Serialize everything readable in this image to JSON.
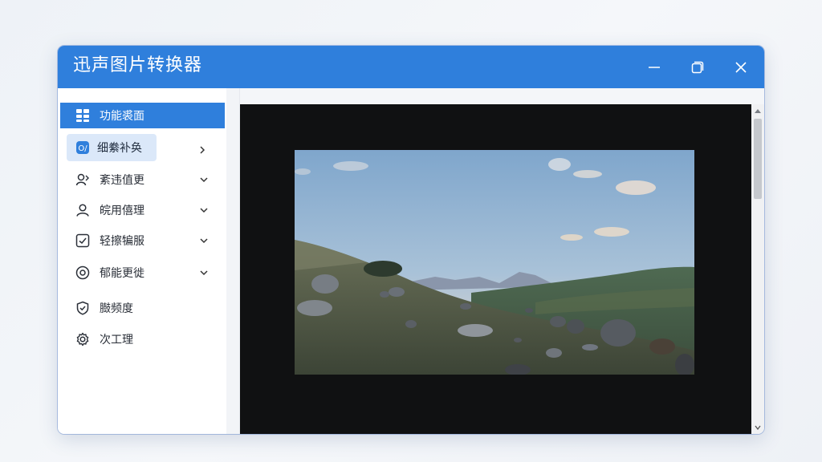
{
  "app": {
    "title": "迅声图片转换器"
  },
  "window_controls": {
    "minimize_icon": "minimize-icon",
    "maximize_icon": "maximize-icon",
    "close_icon": "close-icon"
  },
  "sidebar": {
    "items": [
      {
        "label": "功能裘面",
        "icon": "grid-icon",
        "active": true
      },
      {
        "label": "细絭补奂",
        "icon": "app-icon",
        "expanded_sub": true
      },
      {
        "label": "紊违值更",
        "icon": "user-share-icon"
      },
      {
        "label": "皖用僖理",
        "icon": "user-icon"
      },
      {
        "label": "轻擦犏服",
        "icon": "checkbox-icon"
      },
      {
        "label": "郁能更徙",
        "icon": "target-icon"
      },
      {
        "label": "臌频度",
        "icon": "shield-icon"
      },
      {
        "label": "次工理",
        "icon": "gear-icon"
      }
    ]
  },
  "colors": {
    "accent": "#2f7fdc",
    "sub_highlight": "#dbe8f9",
    "viewer_bg": "#101112"
  },
  "viewer": {
    "image": "landscape-photo"
  }
}
